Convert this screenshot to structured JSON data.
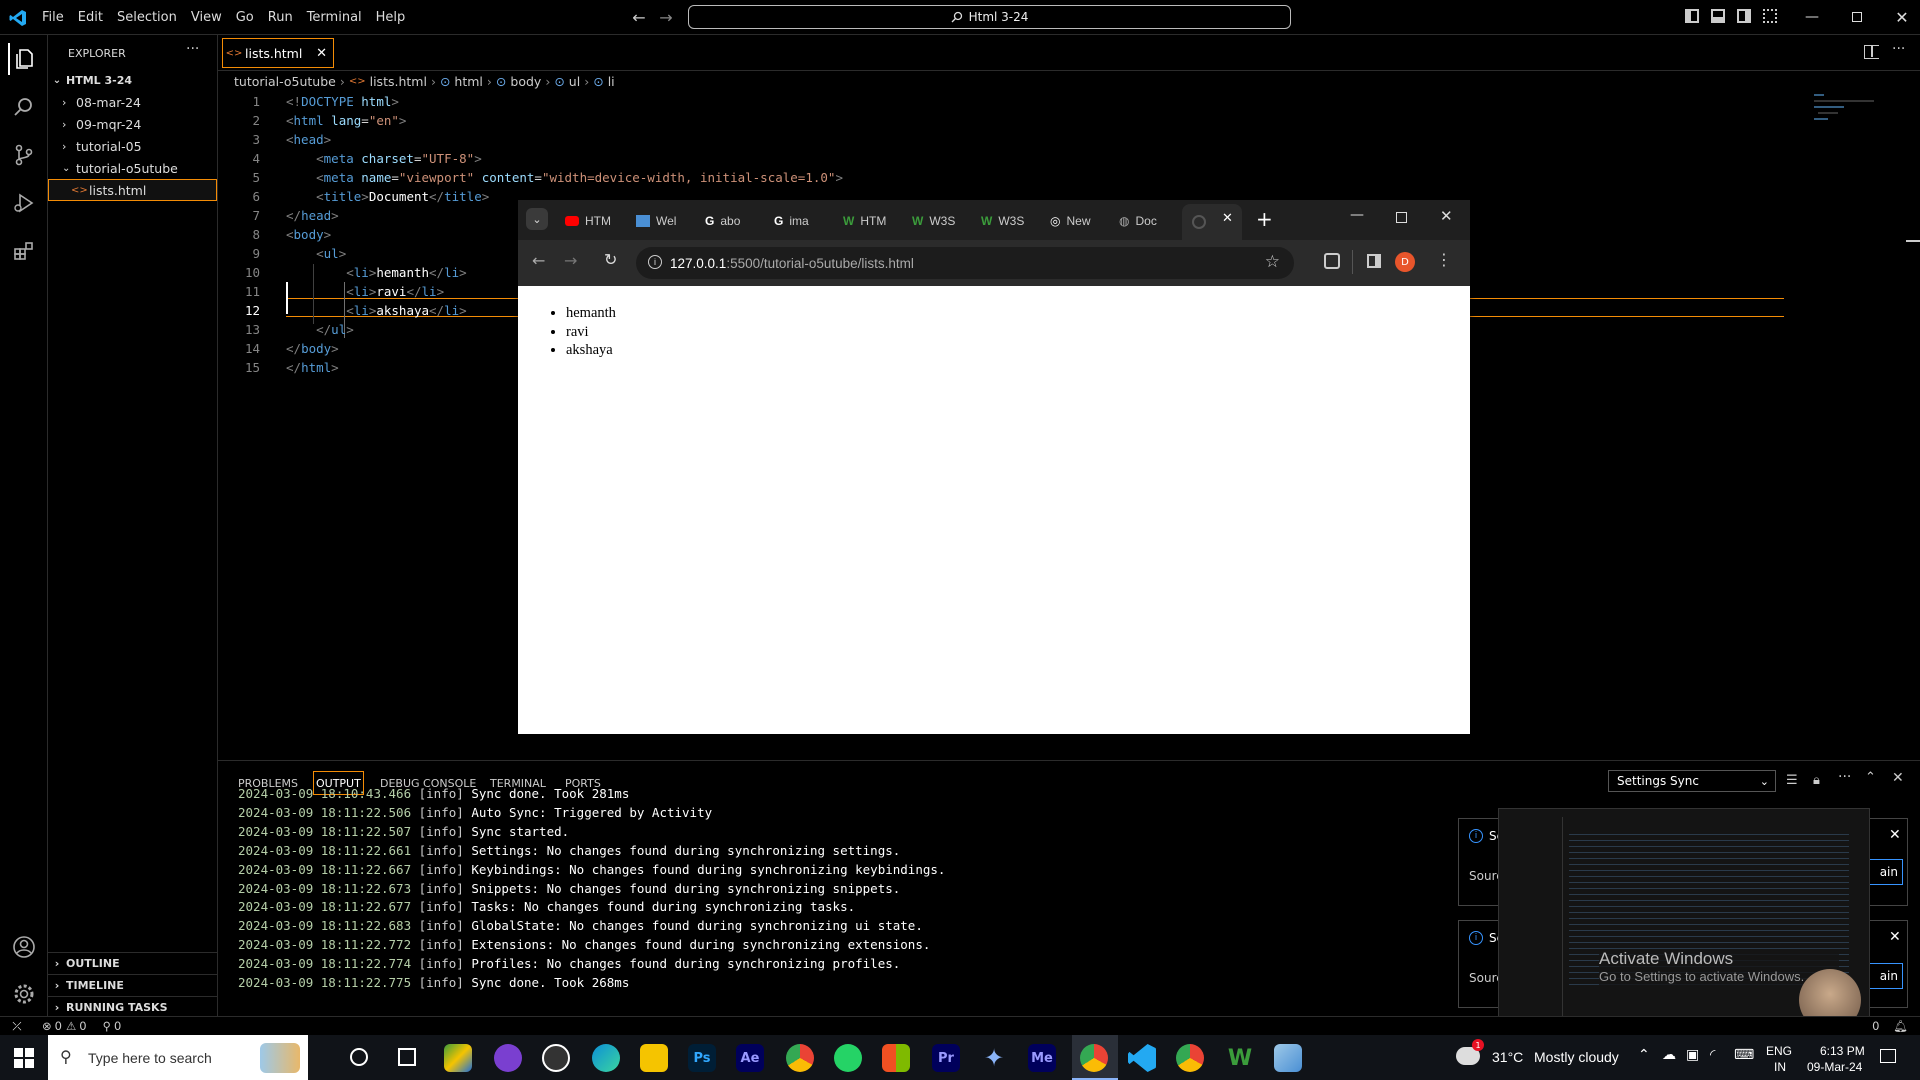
{
  "titlebar": {
    "menu": [
      "File",
      "Edit",
      "Selection",
      "View",
      "Go",
      "Run",
      "Terminal",
      "Help"
    ],
    "command_center": "Html 3-24"
  },
  "sidebar": {
    "header": "EXPLORER",
    "root": "HTML 3-24",
    "items": [
      {
        "label": "08-mar-24"
      },
      {
        "label": "09-mqr-24"
      },
      {
        "label": "tutorial-05"
      },
      {
        "label": "tutorial-o5utube"
      },
      {
        "label": "lists.html"
      }
    ],
    "sections": [
      "OUTLINE",
      "TIMELINE",
      "RUNNING TASKS"
    ]
  },
  "editor": {
    "tab": "lists.html",
    "breadcrumb": [
      "tutorial-o5utube",
      "lists.html",
      "html",
      "body",
      "ul",
      "li"
    ],
    "lines": [
      "1",
      "2",
      "3",
      "4",
      "5",
      "6",
      "7",
      "8",
      "9",
      "10",
      "11",
      "12",
      "13",
      "14",
      "15"
    ]
  },
  "browser": {
    "tabs": [
      "HTM",
      "Wel",
      "abo",
      "ima",
      "HTM",
      "W3S",
      "W3S",
      "New",
      "Doc"
    ],
    "url_host": "127.0.0.1",
    "url_path": ":5500/tutorial-o5utube/lists.html",
    "profile": "D",
    "list": [
      "hemanth",
      "ravi",
      "akshaya"
    ]
  },
  "panel": {
    "tabs": [
      "PROBLEMS",
      "OUTPUT",
      "DEBUG CONSOLE",
      "TERMINAL",
      "PORTS"
    ],
    "channel": "Settings Sync",
    "log": [
      {
        "d": "2024-03-09 18:10:43.466",
        "l": "[info]",
        "m": "Sync done. Took 281ms"
      },
      {
        "d": "2024-03-09 18:11:22.506",
        "l": "[info]",
        "m": "Auto Sync: Triggered by Activity"
      },
      {
        "d": "2024-03-09 18:11:22.507",
        "l": "[info]",
        "m": "Sync started."
      },
      {
        "d": "2024-03-09 18:11:22.661",
        "l": "[info]",
        "m": "Settings: No changes found during synchronizing settings."
      },
      {
        "d": "2024-03-09 18:11:22.667",
        "l": "[info]",
        "m": "Keybindings: No changes found during synchronizing keybindings."
      },
      {
        "d": "2024-03-09 18:11:22.673",
        "l": "[info]",
        "m": "Snippets: No changes found during synchronizing snippets."
      },
      {
        "d": "2024-03-09 18:11:22.677",
        "l": "[info]",
        "m": "Tasks: No changes found during synchronizing tasks."
      },
      {
        "d": "2024-03-09 18:11:22.683",
        "l": "[info]",
        "m": "GlobalState: No changes found during synchronizing ui state."
      },
      {
        "d": "2024-03-09 18:11:22.772",
        "l": "[info]",
        "m": "Extensions: No changes found during synchronizing extensions."
      },
      {
        "d": "2024-03-09 18:11:22.774",
        "l": "[info]",
        "m": "Profiles: No changes found during synchronizing profiles."
      },
      {
        "d": "2024-03-09 18:11:22.775",
        "l": "[info]",
        "m": "Sync done. Took 268ms"
      }
    ]
  },
  "notifications": [
    {
      "title": "Se",
      "source": "Sourc",
      "button": "ain"
    },
    {
      "title": "Se",
      "source": "Sourc",
      "button": "ain"
    }
  ],
  "watermark": {
    "line1": "Activate Windows",
    "line2": "Go to Settings to activate Windows."
  },
  "statusbar": {
    "errors": "0",
    "warnings": "0",
    "ports": "0",
    "right_count": "0"
  },
  "taskbar": {
    "search_placeholder": "Type here to search",
    "weather_temp": "31°C",
    "weather_desc": "Mostly cloudy",
    "weather_badge": "1",
    "lang": "ENG",
    "region": "IN",
    "time": "6:13 PM",
    "date": "09-Mar-24"
  },
  "colors": {
    "accent": "#f48c06",
    "tag": "#569cd6",
    "attr": "#9cdcfe",
    "string": "#ce9178",
    "date": "#b5cea8"
  }
}
